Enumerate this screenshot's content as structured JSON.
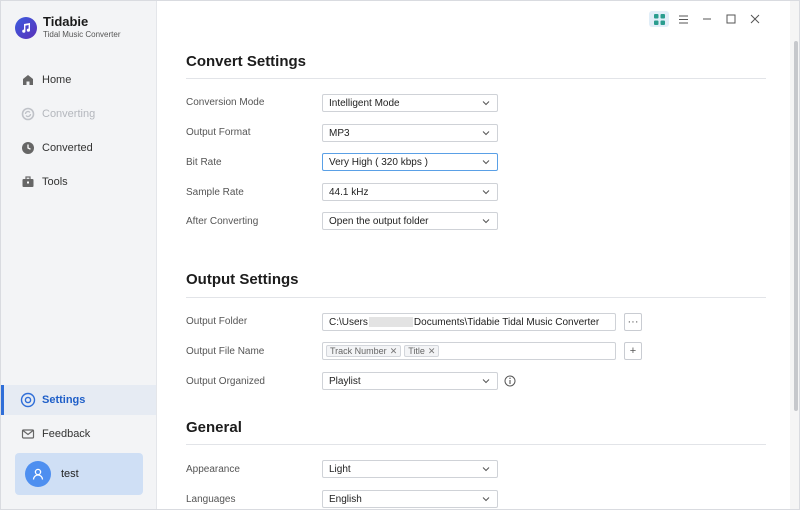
{
  "app": {
    "name": "Tidabie",
    "subtitle": "Tidal Music Converter"
  },
  "sidebar": {
    "items": [
      {
        "label": "Home",
        "icon": "home-icon",
        "state": "normal"
      },
      {
        "label": "Converting",
        "icon": "sync-icon",
        "state": "disabled"
      },
      {
        "label": "Converted",
        "icon": "clock-icon",
        "state": "normal"
      },
      {
        "label": "Tools",
        "icon": "toolbox-icon",
        "state": "normal"
      },
      {
        "label": "Settings",
        "icon": "settings-icon",
        "state": "active"
      },
      {
        "label": "Feedback",
        "icon": "mail-icon",
        "state": "normal"
      }
    ],
    "user": {
      "name": "test"
    }
  },
  "convert_settings": {
    "title": "Convert Settings",
    "conversion_mode": {
      "label": "Conversion Mode",
      "value": "Intelligent Mode"
    },
    "output_format": {
      "label": "Output Format",
      "value": "MP3"
    },
    "bit_rate": {
      "label": "Bit Rate",
      "value": "Very High ( 320 kbps )"
    },
    "sample_rate": {
      "label": "Sample Rate",
      "value": "44.1 kHz"
    },
    "after_converting": {
      "label": "After Converting",
      "value": "Open the output folder"
    }
  },
  "output_settings": {
    "title": "Output Settings",
    "output_folder": {
      "label": "Output Folder",
      "value_prefix": "C:\\Users",
      "value_suffix": "Documents\\Tidabie Tidal Music Converter",
      "browse_label": "···"
    },
    "output_file_name": {
      "label": "Output File Name",
      "tags": [
        "Track Number",
        "Title"
      ],
      "add_label": "+"
    },
    "output_organized": {
      "label": "Output Organized",
      "value": "Playlist"
    }
  },
  "general": {
    "title": "General",
    "appearance": {
      "label": "Appearance",
      "value": "Light"
    },
    "languages": {
      "label": "Languages",
      "value": "English"
    }
  },
  "colors": {
    "accent": "#2f6ed8",
    "sidebar_bg": "#f3f4f6",
    "user_card_bg": "#cfdff5",
    "focus_border": "#5aa0e6"
  }
}
